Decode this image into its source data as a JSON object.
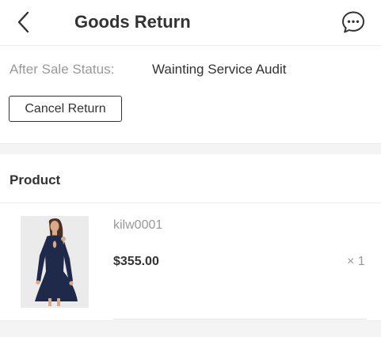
{
  "header": {
    "title": "Goods Return",
    "back_icon": "chevron-left-icon",
    "chat_icon": "chat-bubble-icon"
  },
  "status": {
    "label": "After Sale Status:",
    "value": "Wainting Service Audit",
    "cancel_label": "Cancel Return"
  },
  "product_section": {
    "title": "Product",
    "items": [
      {
        "sku": "kilw0001",
        "price": "$355.00",
        "quantity": "× 1",
        "image": "navy-dress-photo"
      }
    ]
  },
  "colors": {
    "page_bg": "#f4f4f4",
    "card_bg": "#ffffff",
    "text_primary": "#333333",
    "text_muted": "#999999",
    "dress": "#1f2a4a"
  }
}
